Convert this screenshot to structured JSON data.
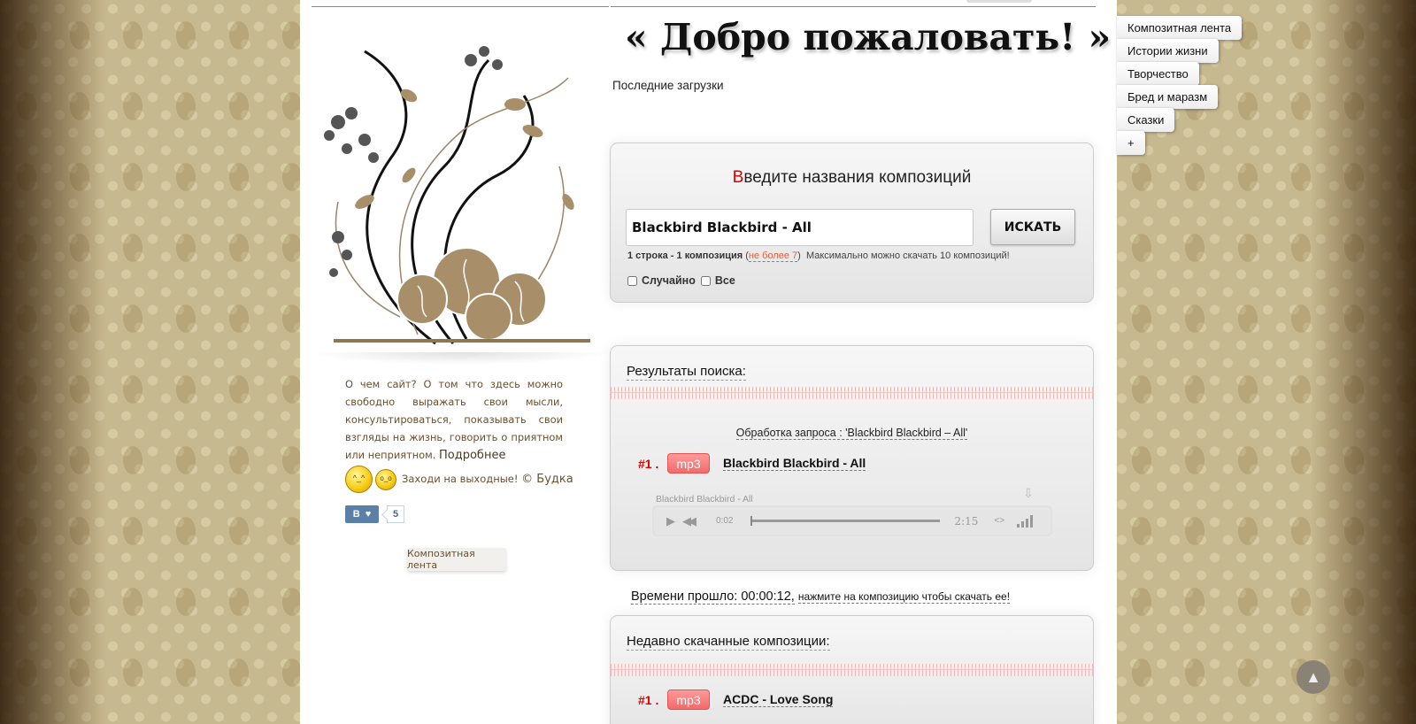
{
  "welcome_title": "« Добро пожаловать! »",
  "recent_uploads_label": "Последние загрузки",
  "about": {
    "text": "О чем сайт? О том что здесь можно свободно выражать свои мысли, консультироваться, показывать свои взгляды на жизнь, говорить о приятном или неприятном.",
    "more_link": "Подробнее"
  },
  "weekend": {
    "text": "Заходи на выходные!",
    "copyright": "© Будка"
  },
  "vk": {
    "letter": "В",
    "count": "5"
  },
  "left_button": "Композитная лента",
  "search": {
    "title_first_letter": "В",
    "title_rest": "ведите названия композиций",
    "input_value": "Blackbird Blackbird - All",
    "button": "ИСКАТЬ",
    "hint_stats": "1 строка - 1 композиция",
    "hint_limit": "не более 7",
    "hint_max": "Максимально можно скачать 10 композиций!",
    "option_random": "Случайно",
    "option_all": "Все"
  },
  "results": {
    "heading": "Результаты поиска:",
    "query": "Обработка запроса : 'Blackbird Blackbird – All'",
    "tracks": [
      {
        "num": "#1 .",
        "format": "mp3",
        "title": "Blackbird Blackbird - All"
      }
    ],
    "player": {
      "name": "Blackbird Blackbird - All",
      "current": "0:02",
      "duration": "2:15",
      "embed": "<>"
    }
  },
  "elapsed": {
    "label": "Времени прошло: 00:00:12,",
    "hint": "нажмите на композицию чтобы скачать ее!"
  },
  "recent": {
    "heading": "Недавно скачанные композиции:",
    "tracks": [
      {
        "num": "#1 .",
        "format": "mp3",
        "title": "ACDC - Love Song"
      }
    ]
  },
  "tags": [
    "Композитная лента",
    "Истории жизни",
    "Творчество",
    "Бред и маразм",
    "Сказки",
    "+"
  ]
}
